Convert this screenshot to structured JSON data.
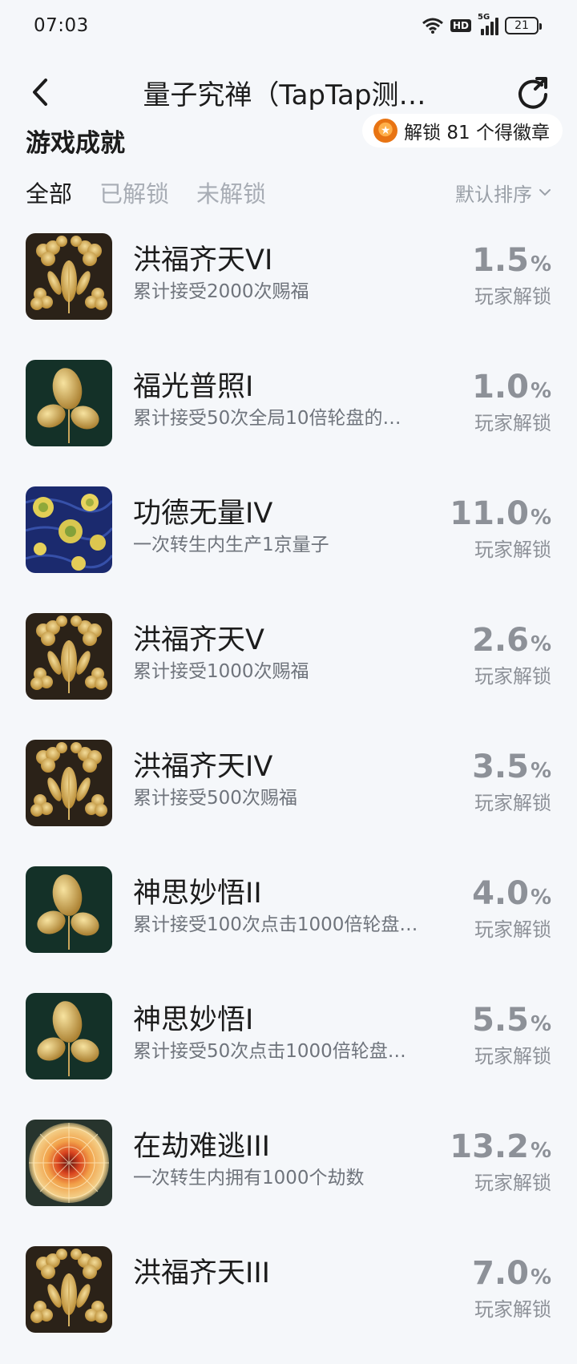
{
  "status": {
    "time": "07:03",
    "hd": "HD",
    "net": "5G",
    "battery": "21"
  },
  "header": {
    "title": "量子究禅（TapTap测…"
  },
  "section": {
    "title": "游戏成就",
    "badge_text": "解锁 81 个得徽章"
  },
  "tabs": [
    {
      "label": "全部",
      "active": true
    },
    {
      "label": "已解锁",
      "active": false
    },
    {
      "label": "未解锁",
      "active": false
    }
  ],
  "sort": {
    "label": "默认排序"
  },
  "achievement_label": "玩家解锁",
  "achievements": [
    {
      "name": "洪福齐天VI",
      "desc": "累计接受2000次赐福",
      "pct": "1.5",
      "icon": "clover-icon"
    },
    {
      "name": "福光普照I",
      "desc": "累计接受50次全局10倍轮盘的…",
      "pct": "1.0",
      "icon": "leaf-icon"
    },
    {
      "name": "功德无量IV",
      "desc": "一次转生内生产1京量子",
      "pct": "11.0",
      "icon": "starry-night-icon"
    },
    {
      "name": "洪福齐天V",
      "desc": "累计接受1000次赐福",
      "pct": "2.6",
      "icon": "clover-icon"
    },
    {
      "name": "洪福齐天IV",
      "desc": "累计接受500次赐福",
      "pct": "3.5",
      "icon": "clover-icon"
    },
    {
      "name": "神思妙悟II",
      "desc": "累计接受100次点击1000倍轮盘…",
      "pct": "4.0",
      "icon": "leaf-icon"
    },
    {
      "name": "神思妙悟I",
      "desc": "累计接受50次点击1000倍轮盘…",
      "pct": "5.5",
      "icon": "leaf-icon"
    },
    {
      "name": "在劫难逃III",
      "desc": "一次转生内拥有1000个劫数",
      "pct": "13.2",
      "icon": "mandala-icon"
    },
    {
      "name": "洪福齐天III",
      "desc": "",
      "pct": "7.0",
      "icon": "clover-icon"
    }
  ],
  "colors": {
    "background": "#f5f7fa",
    "muted": "#8d9198",
    "text": "#1c1c1c"
  }
}
